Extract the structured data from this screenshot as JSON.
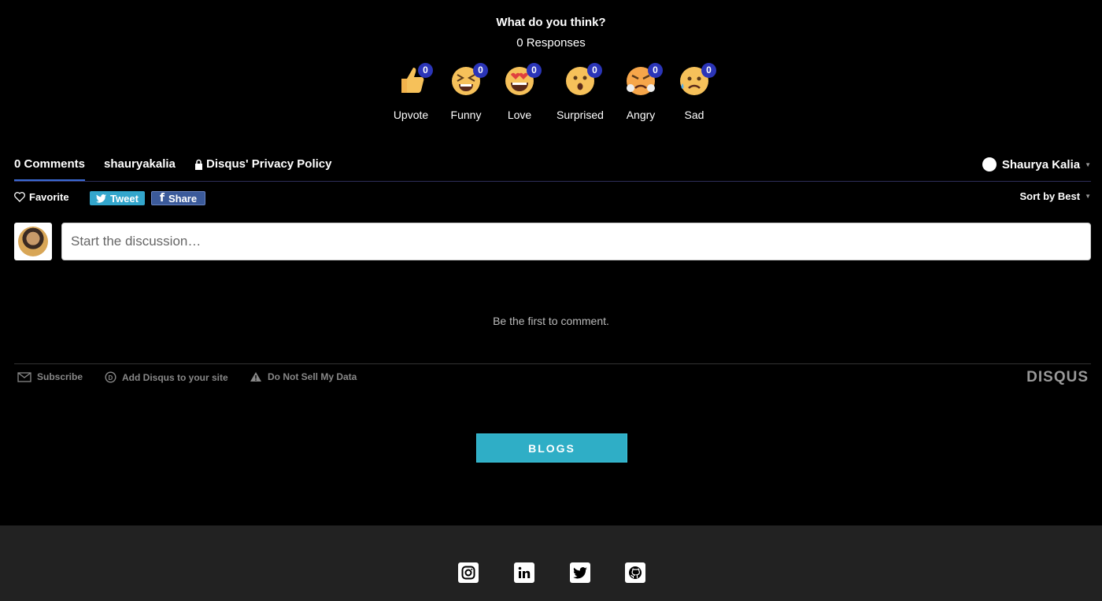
{
  "reactions": {
    "title": "What do you think?",
    "responses": "0 Responses",
    "items": [
      {
        "label": "Upvote",
        "count": "0",
        "icon": "thumbs-up-icon"
      },
      {
        "label": "Funny",
        "count": "0",
        "icon": "laughing-face-icon"
      },
      {
        "label": "Love",
        "count": "0",
        "icon": "heart-eyes-face-icon"
      },
      {
        "label": "Surprised",
        "count": "0",
        "icon": "surprised-face-icon"
      },
      {
        "label": "Angry",
        "count": "0",
        "icon": "angry-face-icon"
      },
      {
        "label": "Sad",
        "count": "0",
        "icon": "sad-face-icon"
      }
    ]
  },
  "nav": {
    "comments_tab": "0 Comments",
    "user_tab": "shauryakalia",
    "privacy_tab": "Disqus' Privacy Policy",
    "account_name": "Shaurya Kalia"
  },
  "actions": {
    "favorite": "Favorite",
    "tweet": "Tweet",
    "share": "Share",
    "sort": "Sort by Best"
  },
  "compose": {
    "placeholder": "Start the discussion…"
  },
  "empty_message": "Be the first to comment.",
  "footer_links": {
    "subscribe": "Subscribe",
    "add_disqus": "Add Disqus to your site",
    "do_not_sell": "Do Not Sell My Data",
    "brand": "DISQUS"
  },
  "blogs_button": "BLOGS",
  "social": [
    "instagram-icon",
    "linkedin-icon",
    "twitter-icon",
    "github-icon"
  ],
  "colors": {
    "background": "#000000",
    "badge": "#2b35b8",
    "tweet": "#33a6cc",
    "share": "#3b5a9a",
    "blogs": "#2faec6",
    "footer": "#222222"
  }
}
